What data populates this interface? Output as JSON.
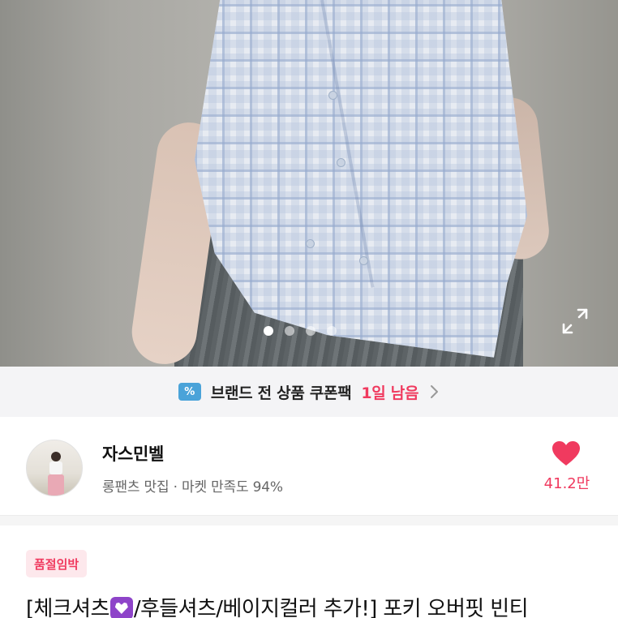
{
  "hero": {
    "image_alt": "plaid short sleeve shirt product photo",
    "carousel": {
      "total": 4,
      "active_index": 0
    }
  },
  "coupon_banner": {
    "text": "브랜드 전 상품 쿠폰팩",
    "highlight": "1일 남음",
    "icon_color": "#4aa3d9",
    "highlight_color": "#f03a5f"
  },
  "shop": {
    "name": "자스민벨",
    "meta": "롱팬츠 맛집 · 마켓 만족도 94%",
    "likes": "41.2만",
    "heart_color": "#f03a5f"
  },
  "product": {
    "badge": "품절임박",
    "title_part1": "[체크셔츠",
    "title_part2": "/후들셔츠/베이지컬러 추가!] 포키 오버핏 빈티"
  }
}
